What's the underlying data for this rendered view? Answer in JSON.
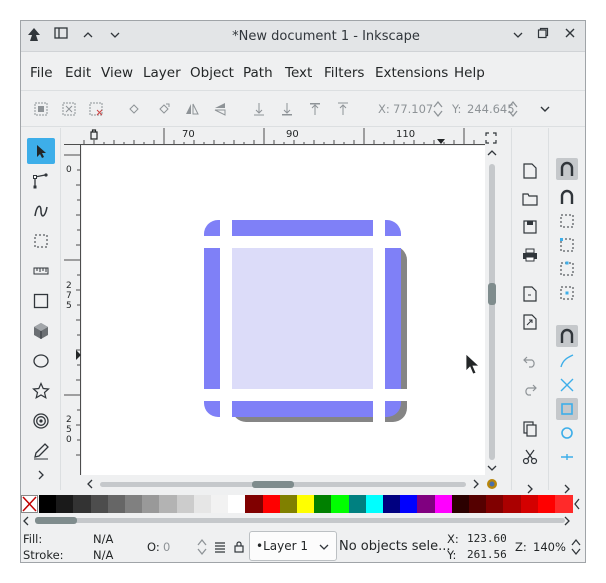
{
  "window": {
    "title": "*New document 1 - Inkscape",
    "controls": [
      "minimize",
      "maximize",
      "close"
    ]
  },
  "menu": [
    "File",
    "Edit",
    "View",
    "Layer",
    "Object",
    "Path",
    "Text",
    "Filters",
    "Extensions",
    "Help"
  ],
  "toolbar": {
    "x_label": "X:",
    "x_value": "77.107",
    "y_label": "Y:",
    "y_value": "244.645"
  },
  "ruler": {
    "top_ticks": [
      "70",
      "90",
      "110"
    ],
    "left_ticks": [
      "0",
      "275",
      "250"
    ]
  },
  "palette_colors": [
    "#000000",
    "#1a1a1a",
    "#333333",
    "#4d4d4d",
    "#666666",
    "#808080",
    "#999999",
    "#b3b3b3",
    "#cccccc",
    "#e6e6e6",
    "#f2f2f2",
    "#ffffff",
    "#800000",
    "#ff0000",
    "#808000",
    "#ffff00",
    "#008000",
    "#00ff00",
    "#008080",
    "#00ffff",
    "#000080",
    "#0000ff",
    "#800080",
    "#ff00ff",
    "#2b0000",
    "#550000",
    "#800000",
    "#aa0000",
    "#d40000",
    "#ff0000",
    "#ff2a2a"
  ],
  "canvas": {
    "frame_color": "#7f80f7",
    "inner_color": "#dcdcf9",
    "shadow_color": "#858585"
  },
  "status": {
    "fill_label": "Fill:",
    "fill_value": "N/A",
    "stroke_label": "Stroke:",
    "stroke_value": "N/A",
    "opacity_label": "O:",
    "opacity_value": "0",
    "layer_name": "•Layer 1",
    "message": "No objects sele...",
    "cursor_x_label": "X:",
    "cursor_x": "123.60",
    "cursor_y_label": "Y:",
    "cursor_y": "261.56",
    "zoom_label": "Z:",
    "zoom": "140%"
  }
}
